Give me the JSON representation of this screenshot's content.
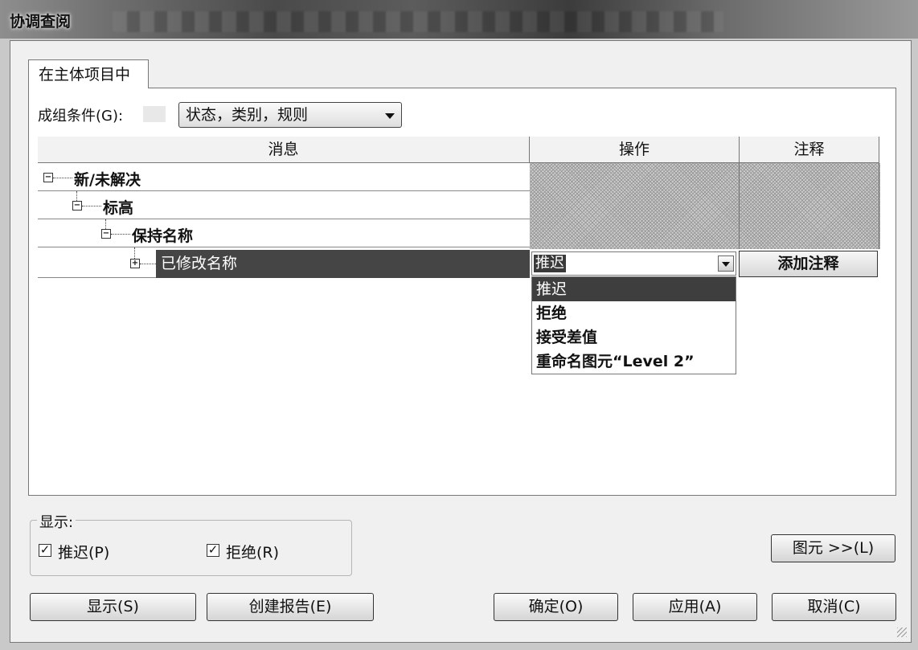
{
  "window": {
    "title": "协调查阅"
  },
  "tab": {
    "label": "在主体项目中"
  },
  "grouping": {
    "label": "成组条件(G):",
    "value": "状态，类别，规则"
  },
  "columns": {
    "message": "消息",
    "action": "操作",
    "comment": "注释"
  },
  "tree": {
    "rows": [
      {
        "label": "新/未解决",
        "expander": "minus"
      },
      {
        "label": "标高",
        "expander": "minus"
      },
      {
        "label": "保持名称",
        "expander": "minus"
      },
      {
        "label": "已修改名称",
        "expander": "plus"
      }
    ]
  },
  "action_dropdown": {
    "value": "推迟",
    "options": [
      "推迟",
      "拒绝",
      "接受差值",
      "重命名图元“Level 2”"
    ],
    "selected_index": 0
  },
  "comment_button": {
    "label": "添加注释"
  },
  "show_group": {
    "label": "显示:",
    "checkboxes": [
      {
        "label": "推迟(P)",
        "checked": true
      },
      {
        "label": "拒绝(R)",
        "checked": true
      }
    ]
  },
  "buttons": {
    "elements": "图元 >>(L)",
    "show": "显示(S)",
    "create_report": "创建报告(E)",
    "ok": "确定(O)",
    "apply": "应用(A)",
    "cancel": "取消(C)"
  }
}
